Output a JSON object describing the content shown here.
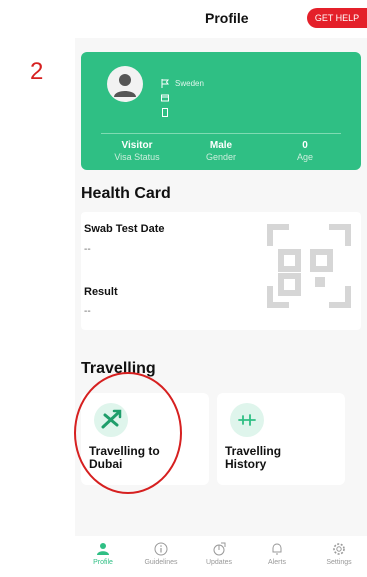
{
  "annotation": {
    "step_number": "2"
  },
  "header": {
    "title": "Profile",
    "get_help_label": "GET HELP"
  },
  "profile_card": {
    "nationality": "Sweden",
    "stats": [
      {
        "value": "Visitor",
        "label": "Visa Status"
      },
      {
        "value": "Male",
        "label": "Gender"
      },
      {
        "value": "0",
        "label": "Age"
      }
    ]
  },
  "health_card": {
    "heading": "Health Card",
    "swab_test_date_label": "Swab Test Date",
    "swab_test_date_value": "--",
    "result_label": "Result",
    "result_value": "--"
  },
  "travelling": {
    "heading": "Travelling",
    "cards": [
      {
        "label_line1": "Travelling to",
        "label_line2": "Dubai",
        "icon": "airplane-icon"
      },
      {
        "label_line1": "Travelling",
        "label_line2": "History",
        "icon": "plane-history-icon"
      }
    ]
  },
  "bottom_nav": {
    "items": [
      {
        "label": "Profile",
        "icon": "person-icon",
        "active": true
      },
      {
        "label": "Guidelines",
        "icon": "info-icon",
        "active": false
      },
      {
        "label": "Updates",
        "icon": "updates-icon",
        "active": false
      },
      {
        "label": "Alerts",
        "icon": "bell-icon",
        "active": false
      },
      {
        "label": "Settings",
        "icon": "gear-icon",
        "active": false
      }
    ]
  },
  "colors": {
    "accent": "#2fbf84",
    "help_button": "#e4202a",
    "annotation": "#d62020"
  }
}
